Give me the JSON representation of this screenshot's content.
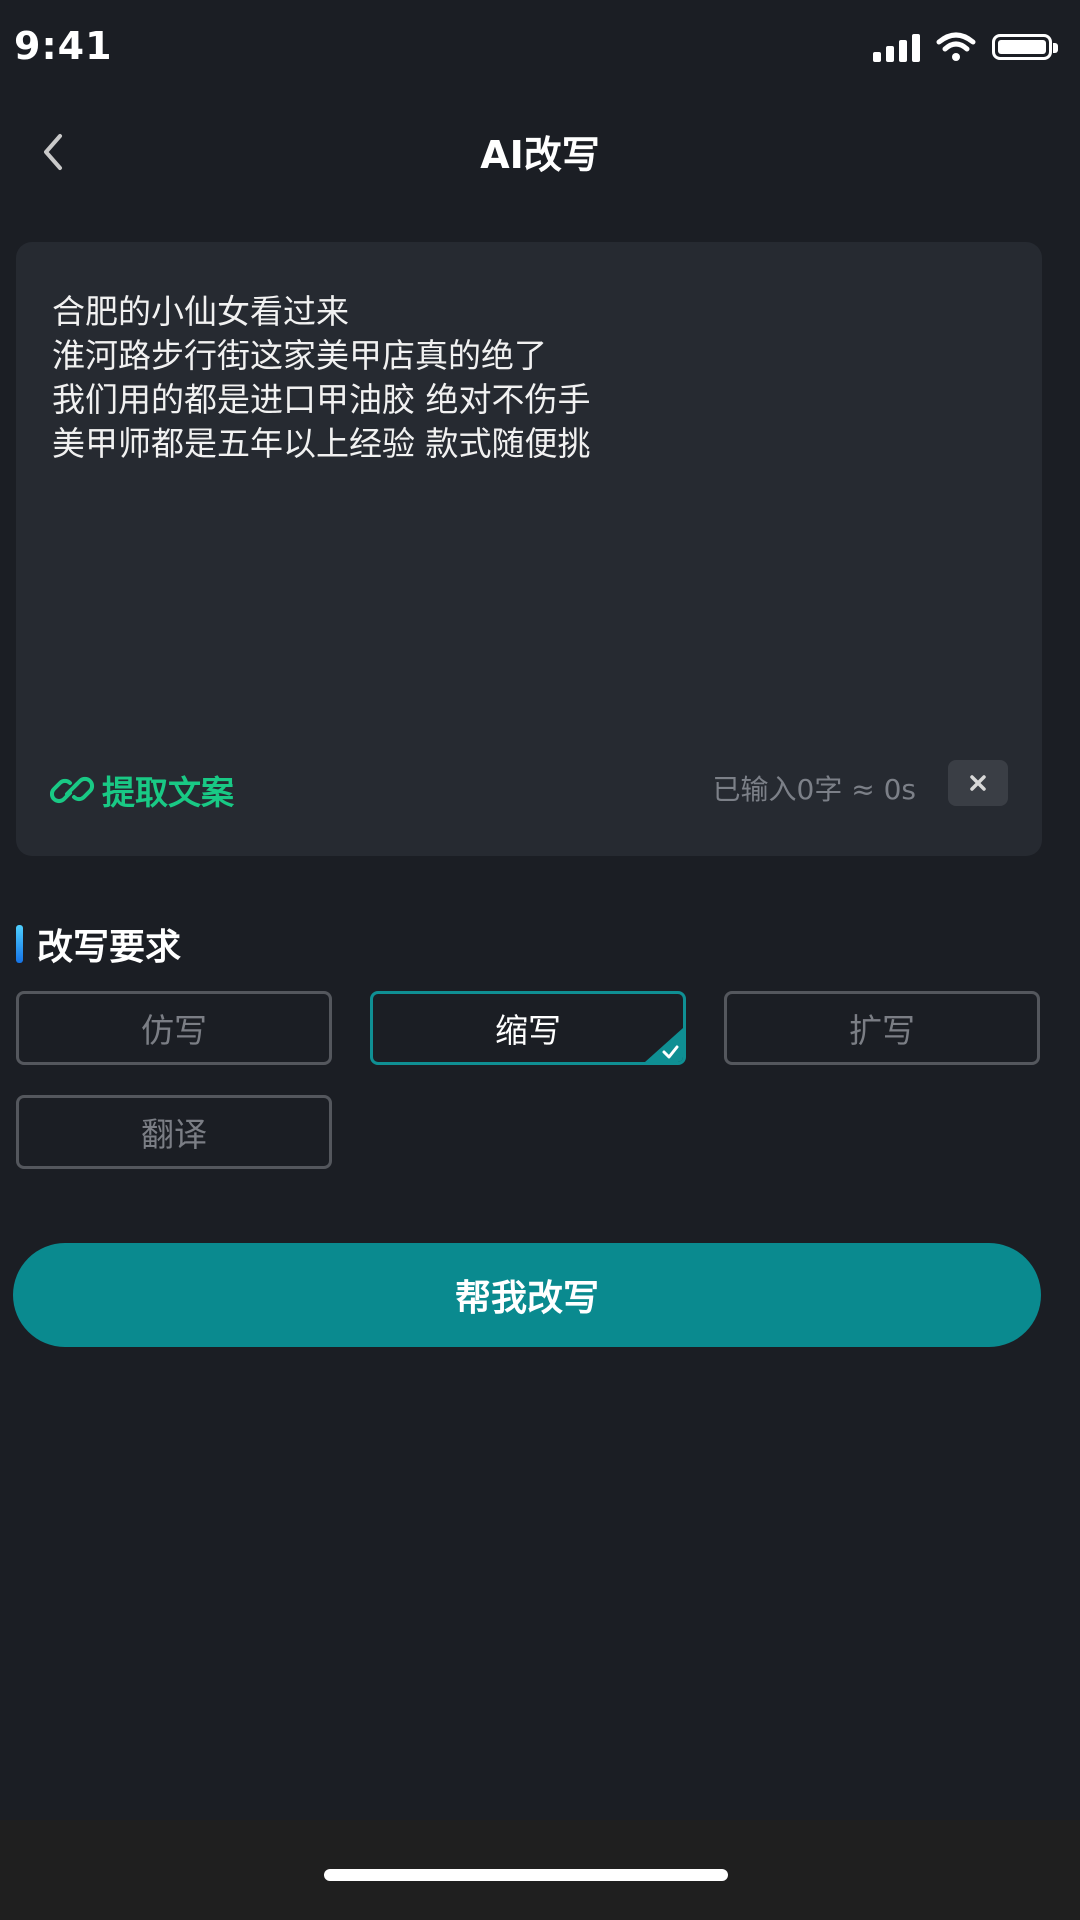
{
  "status_bar": {
    "time": "9:41"
  },
  "header": {
    "title": "AI改写",
    "back_icon": "chevron-left-icon"
  },
  "editor": {
    "lines": [
      "合肥的小仙女看过来",
      "淮河路步行街这家美甲店真的绝了",
      "我们用的都是进口甲油胶 绝对不伤手",
      "美甲师都是五年以上经验 款式随便挑"
    ],
    "extract_label": "提取文案",
    "extract_icon": "link-icon",
    "counter": "已输入0字 ≈ 0s",
    "clear_icon": "close-icon"
  },
  "rewrite": {
    "section_title": "改写要求",
    "options": [
      {
        "label": "仿写",
        "selected": false
      },
      {
        "label": "缩写",
        "selected": true
      },
      {
        "label": "扩写",
        "selected": false
      },
      {
        "label": "翻译",
        "selected": false
      }
    ],
    "submit_label": "帮我改写"
  },
  "colors": {
    "background": "#1b1e24",
    "card": "#262a31",
    "accent_teal": "#0a8a8f",
    "link_green": "#19c985",
    "section_bar_blue": "#1e90ff"
  }
}
